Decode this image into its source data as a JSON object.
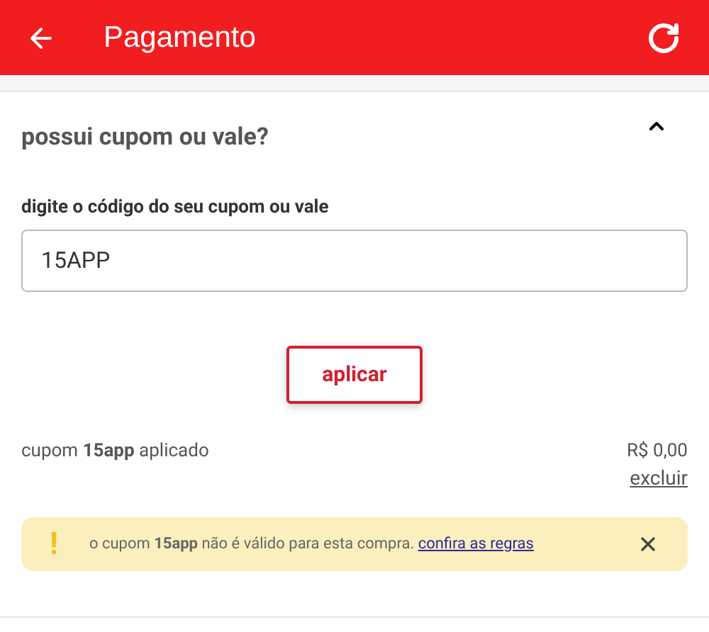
{
  "header": {
    "title": "Pagamento"
  },
  "coupon_section": {
    "title": "possui cupom ou vale?",
    "expanded": true,
    "field": {
      "label": "digite o código do seu cupom ou vale",
      "value": "15APP"
    },
    "apply_button": "aplicar",
    "applied": {
      "text": "cupom **15app** aplicado",
      "amount": "R$ 0,00",
      "remove_link": "excluir"
    },
    "alert": {
      "icon": "!",
      "message": "o cupom **15app** não é válido para esta compra.",
      "link": "confira as regras"
    }
  }
}
